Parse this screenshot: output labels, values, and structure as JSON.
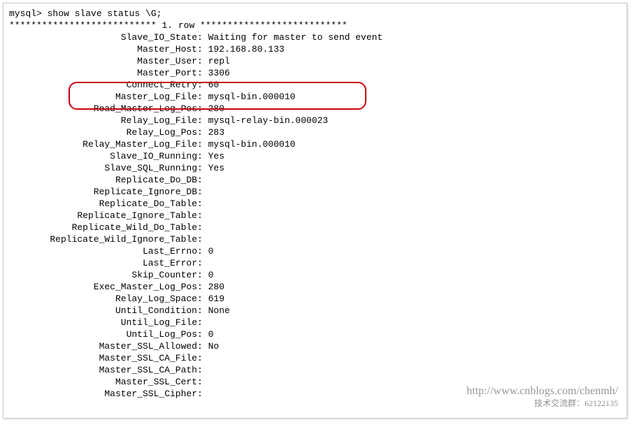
{
  "prompt": "mysql> show slave status \\G;",
  "row_header": "*************************** 1. row ***************************",
  "fields": [
    {
      "key": "Slave_IO_State",
      "value": "Waiting for master to send event"
    },
    {
      "key": "Master_Host",
      "value": "192.168.80.133"
    },
    {
      "key": "Master_User",
      "value": "repl"
    },
    {
      "key": "Master_Port",
      "value": "3306"
    },
    {
      "key": "Connect_Retry",
      "value": "60"
    },
    {
      "key": "Master_Log_File",
      "value": "mysql-bin.000010"
    },
    {
      "key": "Read_Master_Log_Pos",
      "value": "280"
    },
    {
      "key": "Relay_Log_File",
      "value": "mysql-relay-bin.000023"
    },
    {
      "key": "Relay_Log_Pos",
      "value": "283"
    },
    {
      "key": "Relay_Master_Log_File",
      "value": "mysql-bin.000010"
    },
    {
      "key": "Slave_IO_Running",
      "value": "Yes"
    },
    {
      "key": "Slave_SQL_Running",
      "value": "Yes"
    },
    {
      "key": "Replicate_Do_DB",
      "value": ""
    },
    {
      "key": "Replicate_Ignore_DB",
      "value": ""
    },
    {
      "key": "Replicate_Do_Table",
      "value": ""
    },
    {
      "key": "Replicate_Ignore_Table",
      "value": ""
    },
    {
      "key": "Replicate_Wild_Do_Table",
      "value": ""
    },
    {
      "key": "Replicate_Wild_Ignore_Table",
      "value": ""
    },
    {
      "key": "Last_Errno",
      "value": "0"
    },
    {
      "key": "Last_Error",
      "value": ""
    },
    {
      "key": "Skip_Counter",
      "value": "0"
    },
    {
      "key": "Exec_Master_Log_Pos",
      "value": "280"
    },
    {
      "key": "Relay_Log_Space",
      "value": "619"
    },
    {
      "key": "Until_Condition",
      "value": "None"
    },
    {
      "key": "Until_Log_File",
      "value": ""
    },
    {
      "key": "Until_Log_Pos",
      "value": "0"
    },
    {
      "key": "Master_SSL_Allowed",
      "value": "No"
    },
    {
      "key": "Master_SSL_CA_File",
      "value": ""
    },
    {
      "key": "Master_SSL_CA_Path",
      "value": ""
    },
    {
      "key": "Master_SSL_Cert",
      "value": ""
    },
    {
      "key": "Master_SSL_Cipher",
      "value": ""
    }
  ],
  "watermark_url": "http://www.cnblogs.com/chenmh/",
  "watermark_note": "技术交流群：62122135"
}
